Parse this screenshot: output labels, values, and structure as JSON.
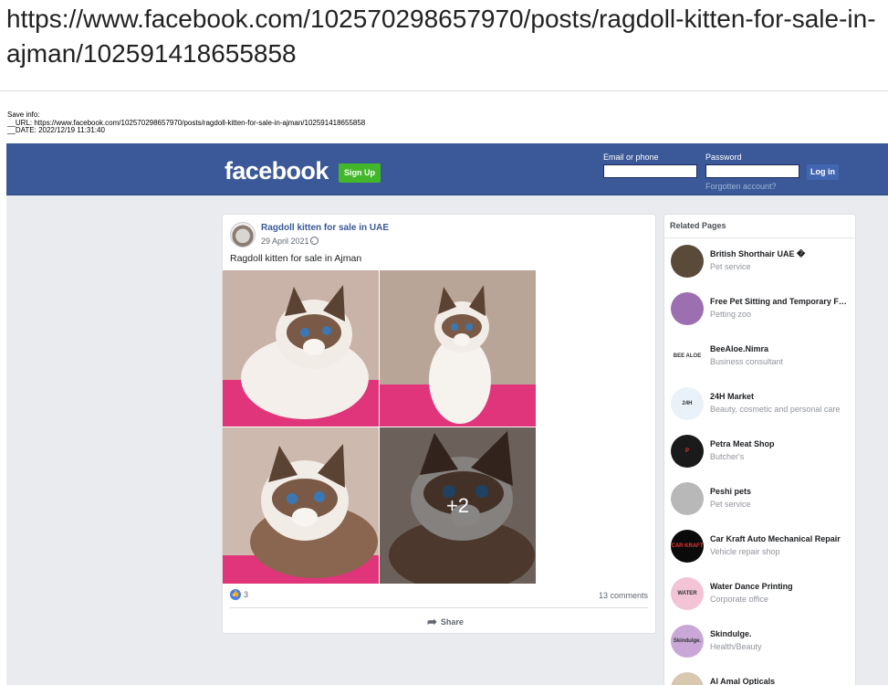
{
  "page": {
    "url_heading": "https://www.facebook.com/102570298657970/posts/ragdoll-kitten-for-sale-in-ajman/102591418655858",
    "save_info": {
      "label": "Save info:",
      "url_line": "__URL: https://www.facebook.com/102570298657970/posts/ragdoll-kitten-for-sale-in-ajman/102591418655858",
      "date_line": "__DATE: 2022/12/19 11:31:40"
    }
  },
  "topbar": {
    "logo": "facebook",
    "signup_label": "Sign Up",
    "email_label": "Email or phone",
    "email_value": "",
    "password_label": "Password",
    "password_value": "",
    "login_label": "Log in",
    "forgot_label": "Forgotten account?",
    "colors": {
      "bar": "#3b5998",
      "signup": "#42b72a",
      "login": "#4267b2"
    }
  },
  "post": {
    "page_name": "Ragdoll kitten for sale in UAE",
    "date": "29 April 2021 ·",
    "text": "Ragdoll kitten for sale in Ajman",
    "photos": [
      {
        "icon": "cat-photo-1"
      },
      {
        "icon": "cat-photo-2"
      },
      {
        "icon": "cat-photo-3"
      },
      {
        "icon": "cat-photo-4",
        "more_label": "+2"
      }
    ],
    "like_count": "3",
    "comments": "13 comments",
    "share_label": "Share"
  },
  "related": {
    "title": "Related Pages",
    "items": [
      {
        "name": "British Shorthair UAE �",
        "category": "Pet service",
        "avatar_color": "#5a4a3a"
      },
      {
        "name": "Free Pet Sitting and Temporary F…",
        "category": "Petting zoo",
        "avatar_color": "#9b6fb0"
      },
      {
        "name": "BeeAloe.Nimra",
        "category": "Business consultant",
        "avatar_color": "#ffffff",
        "avatar_text": "BEE ALOE"
      },
      {
        "name": "24H Market",
        "category": "Beauty, cosmetic and personal care",
        "avatar_color": "#e8f2f8",
        "avatar_text": "24H"
      },
      {
        "name": "Petra Meat Shop",
        "category": "Butcher's",
        "avatar_color": "#1a1a1a",
        "avatar_text": "P"
      },
      {
        "name": "Peshi pets",
        "category": "Pet service",
        "avatar_color": "#b8b8b8"
      },
      {
        "name": "Car Kraft Auto Mechanical Repair",
        "category": "Vehicle repair shop",
        "avatar_color": "#0a0a0a",
        "avatar_text": "CAR KRAFT"
      },
      {
        "name": "Water Dance Printing",
        "category": "Corporate office",
        "avatar_color": "#f2c4d6",
        "avatar_text": "WATER DANCE"
      },
      {
        "name": "Skindulge.",
        "category": "Health/Beauty",
        "avatar_color": "#c9a8d8",
        "avatar_text": "Skindulge."
      },
      {
        "name": "Al Amal Opticals",
        "category": "",
        "avatar_color": "#d8c8b0"
      }
    ]
  }
}
